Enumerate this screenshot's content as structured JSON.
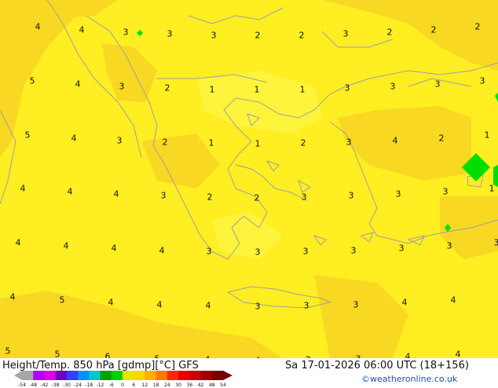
{
  "header": {
    "title": "Height/Temp. 850 hPa [gdmp][°C] GFS",
    "run_info": "Sa 17-01-2026 06:00 UTC (18+156)",
    "credit": "©weatheronline.co.uk"
  },
  "colors": {
    "field_main": "#ffee22",
    "field_warm": "#f8d822",
    "field_light": "#fff43c",
    "coast": "#a0a0a0",
    "green_patch": "#00dd00"
  },
  "map_labels": [
    "4",
    "4",
    "3",
    "3",
    "3",
    "2",
    "2",
    "3",
    "2",
    "2",
    "2",
    "5",
    "4",
    "3",
    "2",
    "1",
    "1",
    "1",
    "3",
    "3",
    "3",
    "3",
    "5",
    "4",
    "3",
    "2",
    "1",
    "1",
    "2",
    "3",
    "4",
    "2",
    "1",
    "4",
    "4",
    "4",
    "3",
    "2",
    "2",
    "3",
    "3",
    "3",
    "3",
    "1",
    "4",
    "4",
    "4",
    "4",
    "3",
    "3",
    "3",
    "3",
    "3",
    "3",
    "3",
    "4",
    "5",
    "4",
    "4",
    "4",
    "3",
    "3",
    "3",
    "4",
    "4",
    "5",
    "5",
    "6",
    "5",
    "4",
    "4",
    "3",
    "3",
    "4",
    "4"
  ],
  "color_scale": {
    "ticks": [
      "-54",
      "-48",
      "-42",
      "-38",
      "-30",
      "-24",
      "-18",
      "-12",
      "-6",
      "0",
      "6",
      "12",
      "18",
      "24",
      "30",
      "36",
      "42",
      "48",
      "54"
    ],
    "colors": [
      "#a6a6a6",
      "#b000ff",
      "#e000e0",
      "#7000c0",
      "#3040ff",
      "#0090ff",
      "#00c8c8",
      "#00a000",
      "#00d000",
      "#e6e600",
      "#ffd200",
      "#ffb000",
      "#ff7800",
      "#ff2800",
      "#e60000",
      "#c80000",
      "#a00000",
      "#780000"
    ]
  }
}
